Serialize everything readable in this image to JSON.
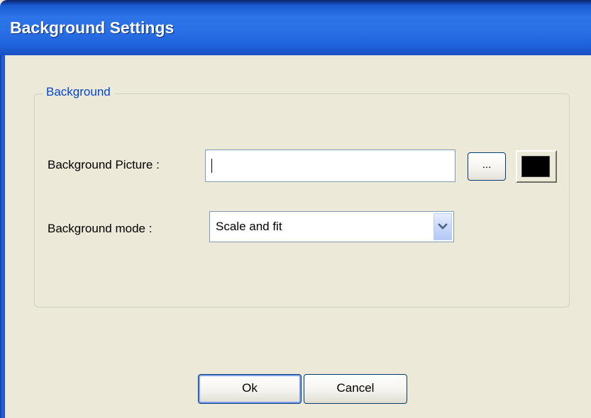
{
  "window": {
    "title": "Background Settings"
  },
  "group": {
    "legend": "Background"
  },
  "picture": {
    "label": "Background Picture :",
    "value": "",
    "browse_label": "...",
    "color": "#000000"
  },
  "mode": {
    "label": "Background mode :",
    "selected": "Scale and fit"
  },
  "buttons": {
    "ok": "Ok",
    "cancel": "Cancel"
  },
  "icons": {
    "combo_arrow": "chevron-down-icon"
  },
  "colors": {
    "titlebar": "#2a70e6",
    "face": "#ece9d8",
    "legend": "#0046d5"
  }
}
